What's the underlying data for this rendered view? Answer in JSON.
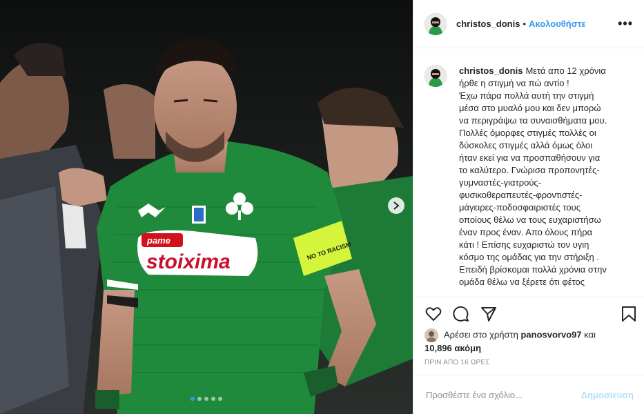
{
  "post": {
    "username": "christos_donis",
    "separator": "•",
    "follow_label": "Ακολουθήστε",
    "more_label": "•••",
    "caption_lines": [
      "Μετά απο 12 χρόνια",
      "ήρθε η στιγμή να πώ αντίο !",
      "Έχω πάρα πολλά αυτή την στιγμή",
      "μέσα στο μυαλό μου και δεν μπορώ",
      "να περιγράψω τα συναισθήματα μου.",
      "Πολλές όμορφες στιγμές πολλές οι",
      "δύσκολες στιγμές αλλά όμως όλοι",
      "ήταν εκεί για να προσπαθήσουν για",
      "το καλύτερο. Γνώρισα προπονητές-",
      "γυμναστές-γιατρούς-",
      "φυσικοθεραπευτές-φροντιστές-",
      "μάγειρες-ποδοσφαιριστές τους",
      "οποίους θέλω να τους ευχαριστήσω",
      "έναν προς έναν. Απο όλους πήρα",
      "κάτι ! Επίσης ευχαριστώ τον υγιη",
      "κόσμο της ομάδας για την στήριξη .",
      "Επειδή βρίσκομαι πολλά χρόνια στην",
      "ομάδα θέλω να ξέρετε ότι φέτος"
    ],
    "likes": {
      "prefix": "Αρέσει στο χρήστη",
      "user": "panosvorvo97",
      "conj": "και",
      "count": "10,896 ακόμη"
    },
    "timestamp": "ΠΡΙΝ ΑΠΟ 16 ΩΡΕΣ",
    "comment": {
      "placeholder": "Προσθέστε ένα σχόλιο...",
      "post_label": "Δημοσίευση"
    },
    "photo": {
      "jersey_sponsor_top": "pame",
      "jersey_sponsor": "stoixima",
      "armband_text": "NO TO RACISM",
      "carousel_count": 5,
      "carousel_active": 1
    }
  },
  "colors": {
    "accent": "#3897f0",
    "jersey_green": "#1f8a3c",
    "armband": "#d4f53c"
  }
}
